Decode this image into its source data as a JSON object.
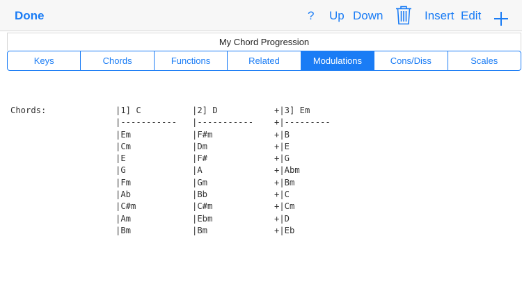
{
  "navbar": {
    "done": "Done",
    "help": "?",
    "up": "Up",
    "down": "Down",
    "trash_icon": "trash-icon",
    "insert": "Insert",
    "edit": "Edit",
    "plus_icon": "plus-icon",
    "accent_color": "#1a7cf5"
  },
  "title": "My Chord Progression",
  "tabs": [
    "Keys",
    "Chords",
    "Functions",
    "Related",
    "Modulations",
    "Cons/Diss",
    "Scales"
  ],
  "active_tab": "Modulations",
  "content": {
    "label": "Chords:",
    "columns": [
      {
        "header": "|1] C",
        "divider": "|-----------",
        "chords": [
          "|Em",
          "|Cm",
          "|E",
          "|G",
          "|Fm",
          "|Ab",
          "|C#m",
          "|Am",
          "|Bm"
        ]
      },
      {
        "header": "|2] D",
        "divider": "|-----------",
        "chords": [
          "|F#m",
          "|Dm",
          "|F#",
          "|A",
          "|Gm",
          "|Bb",
          "|C#m",
          "|Ebm",
          "|Bm"
        ]
      },
      {
        "header": "+|3] Em",
        "divider": "+|---------",
        "chords": [
          "+|B",
          "+|E",
          "+|G",
          "+|Abm",
          "+|Bm",
          "+|C",
          "+|Cm",
          "+|D",
          "+|Eb"
        ]
      }
    ]
  }
}
